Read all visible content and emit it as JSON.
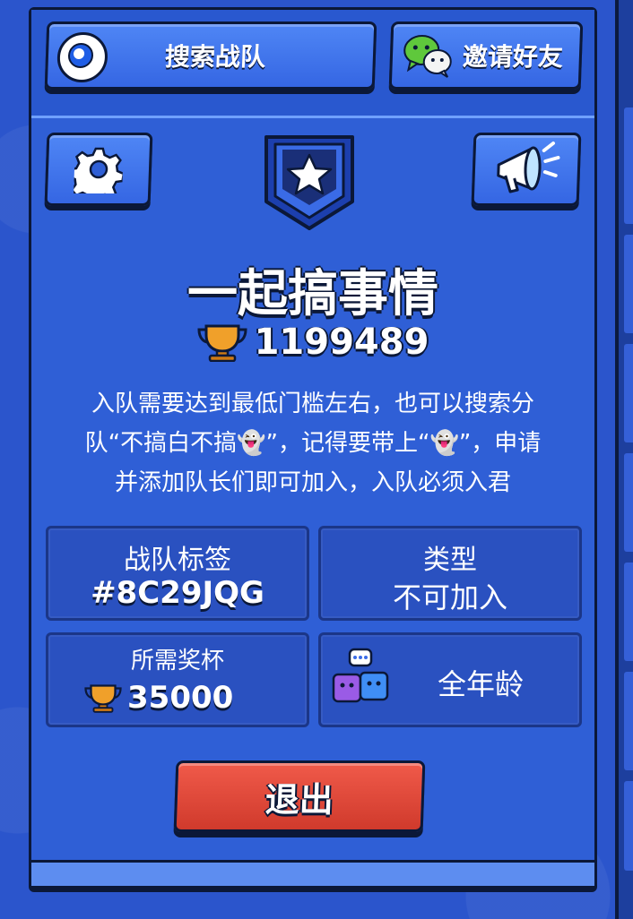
{
  "header": {
    "search_label": "搜索战队",
    "invite_label": "邀请好友"
  },
  "club": {
    "name": "一起搞事情",
    "trophies": "1199489",
    "description_lines": [
      "入队需要达到最低门槛左右，也可以搜索分",
      "队“不搞白不搞👻”，记得要带上“👻”，申请",
      "并添加队长们即可加入，入队必须入君"
    ]
  },
  "info": {
    "tag_title": "战队标签",
    "tag_value": "#8C29JQG",
    "type_title": "类型",
    "type_value": "不可加入",
    "required_title": "所需奖杯",
    "required_value": "35000",
    "age_value": "全年龄"
  },
  "actions": {
    "exit_label": "退出"
  },
  "colors": {
    "panel": "#2f5fd6",
    "button": "#3f74ee",
    "exit": "#e04a3a",
    "outline": "#0b1838"
  }
}
